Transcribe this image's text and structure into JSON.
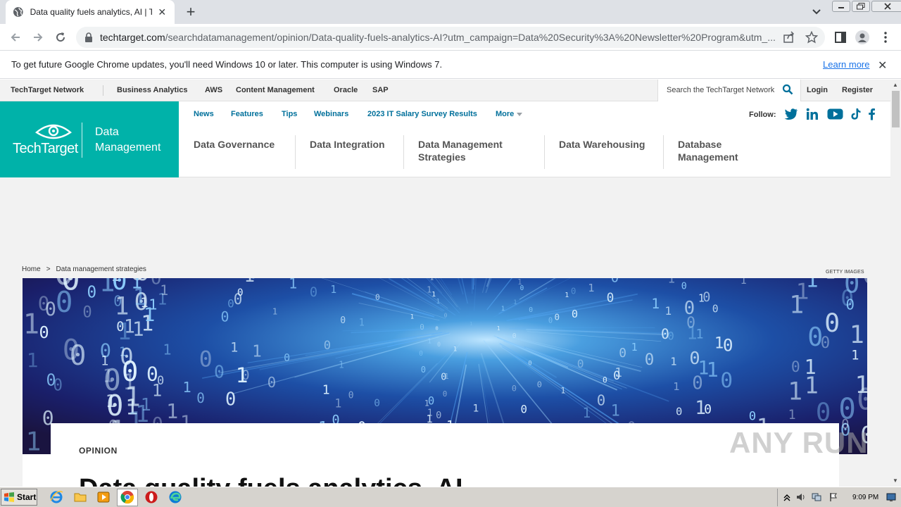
{
  "browser": {
    "tab_title": "Data quality fuels analytics, AI | TechTarget",
    "new_tab_symbol": "+",
    "close_symbol": "✕",
    "url_host": "techtarget.com",
    "url_path": "/searchdatamanagement/opinion/Data-quality-fuels-analytics-AI?utm_campaign=Data%20Security%3A%20Newsletter%20Program&utm_..."
  },
  "infobar": {
    "message": "To get future Google Chrome updates, you'll need Windows 10 or later. This computer is using Windows 7.",
    "learn_more": "Learn more",
    "close_symbol": "✕"
  },
  "network_bar": {
    "brand": "TechTarget Network",
    "links": [
      "Business Analytics",
      "AWS",
      "Content Management",
      "Oracle",
      "SAP"
    ],
    "search_placeholder": "Search the TechTarget Network",
    "login": "Login",
    "register": "Register"
  },
  "site": {
    "logo_text": "TechTarget",
    "site_name_line1": "Data",
    "site_name_line2": "Management",
    "accent_color": "#00b2a9",
    "link_color": "#00709b"
  },
  "subnav": {
    "links": [
      "News",
      "Features",
      "Tips",
      "Webinars",
      "2023 IT Salary Survey Results",
      "More"
    ],
    "follow_label": "Follow:",
    "social_icons": [
      "twitter-icon",
      "linkedin-icon",
      "youtube-icon",
      "tiktok-icon",
      "facebook-icon"
    ]
  },
  "topics": {
    "items": [
      {
        "line1": "Data Governance",
        "line2": ""
      },
      {
        "line1": "Data Integration",
        "line2": ""
      },
      {
        "line1": "Data Management",
        "line2": "Strategies"
      },
      {
        "line1": "Data Warehousing",
        "line2": ""
      },
      {
        "line1": "Database",
        "line2": "Management"
      }
    ]
  },
  "breadcrumb": {
    "home": "Home",
    "separator": ">",
    "current": "Data management strategies"
  },
  "hero": {
    "credit": "GETTY IMAGES"
  },
  "article": {
    "kicker": "OPINION",
    "headline": "Data quality fuels analytics, AI"
  },
  "watermark": "ANY RUN",
  "taskbar": {
    "start_label": "Start",
    "clock": "9:09 PM"
  }
}
